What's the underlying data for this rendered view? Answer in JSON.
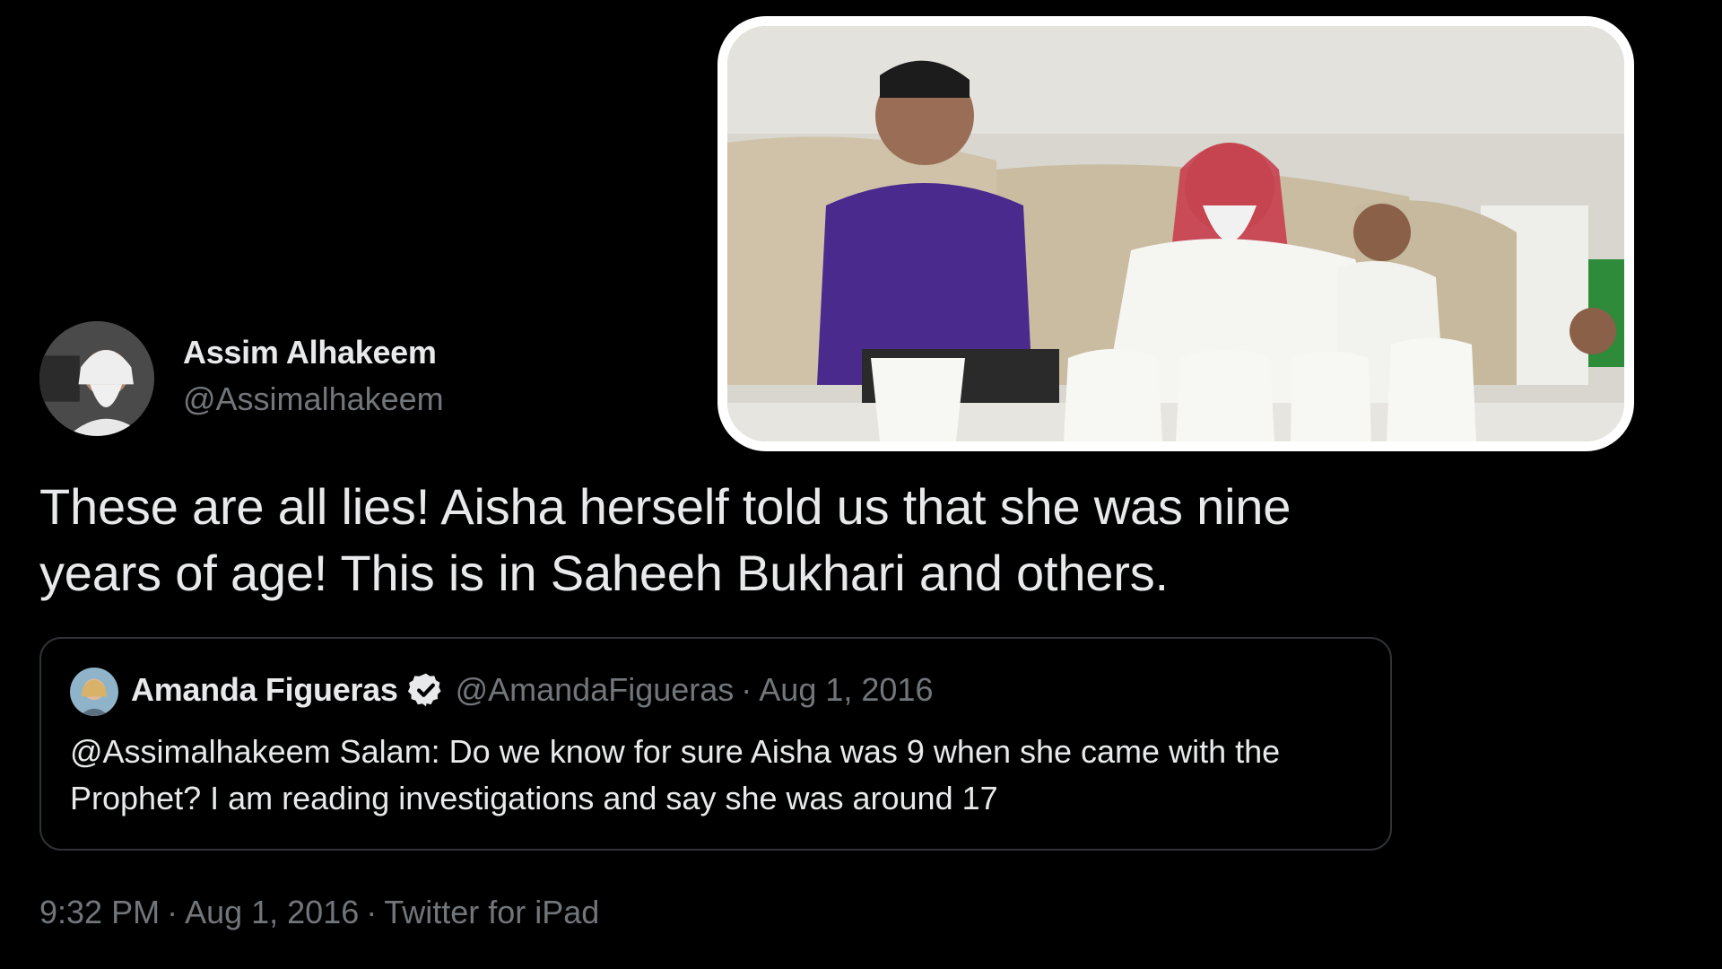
{
  "tweet": {
    "author_name": "Assim Alhakeem",
    "author_handle": "@Assimalhakeem",
    "text": "These are all lies! Aisha herself told us that she was nine years of age! This is in Saheeh Bukhari and others.",
    "time": "9:32 PM",
    "date": "Aug 1, 2016",
    "client": "Twitter for iPad",
    "separator": "·"
  },
  "quoted_tweet": {
    "author_name": "Amanda Figueras",
    "author_handle": "@AmandaFigueras",
    "separator": "·",
    "date": "Aug 1, 2016",
    "verified": true,
    "text": "@Assimalhakeem Salam: Do we know for sure Aisha was 9 when she came with the  Prophet? I am reading investigations and say she was around 17"
  },
  "video_inset": {
    "description_icon": "video-frame"
  },
  "colors": {
    "background": "#000000",
    "primary_text": "#e7e9ea",
    "secondary_text": "#71767b",
    "quote_border": "#2f3336",
    "jersey_purple": "#4b2a8e"
  }
}
